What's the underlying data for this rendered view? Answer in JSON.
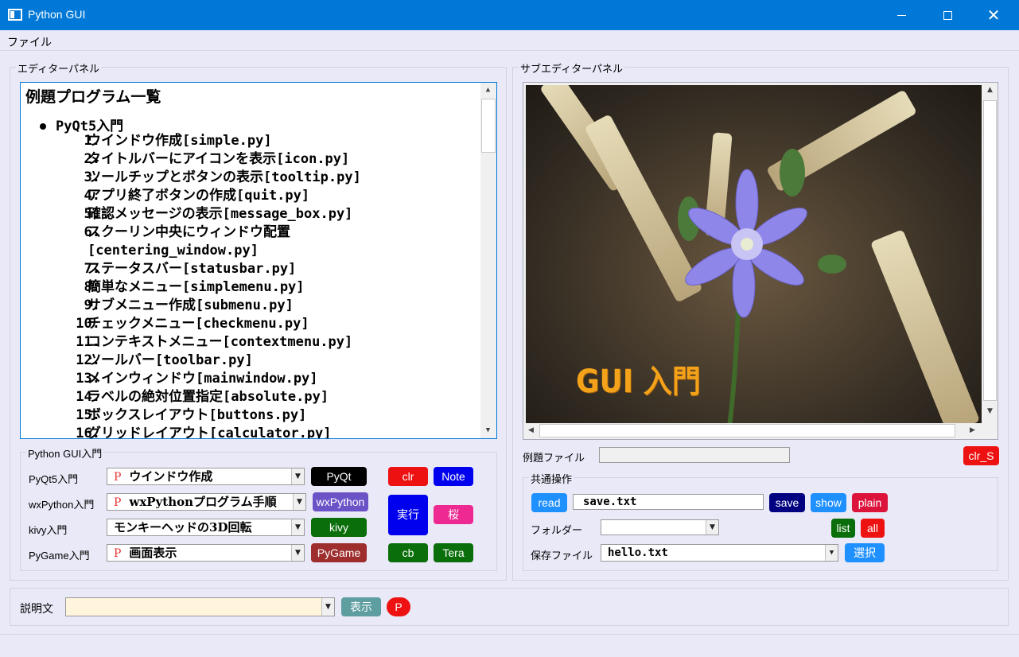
{
  "window": {
    "title": "Python GUI"
  },
  "menu": {
    "file": "ファイル"
  },
  "editor_panel": {
    "title": "エディターパネル",
    "heading": "例題プログラム一覧",
    "section": "PyQt5入門",
    "items": [
      {
        "num": "1.",
        "text": "ウインドウ作成[simple.py]"
      },
      {
        "num": "2.",
        "text": "タイトルバーにアイコンを表示[icon.py]"
      },
      {
        "num": "3.",
        "text": "ツールチップとボタンの表示[tooltip.py]"
      },
      {
        "num": "4.",
        "text": "アプリ終了ボタンの作成[quit.py]"
      },
      {
        "num": "5.",
        "text": "確認メッセージの表示[message_box.py]"
      },
      {
        "num": "6.",
        "text": "スクーリン中央にウィンドウ配置"
      },
      {
        "num": "",
        "text": "[centering_window.py]"
      },
      {
        "num": "7.",
        "text": "ステータスバー[statusbar.py]"
      },
      {
        "num": "8.",
        "text": "簡単なメニュー[simplemenu.py]"
      },
      {
        "num": "9.",
        "text": "サブメニュー作成[submenu.py]"
      },
      {
        "num": "10.",
        "text": "チェックメニュー[checkmenu.py]"
      },
      {
        "num": "11.",
        "text": "コンテキストメニュー[contextmenu.py]"
      },
      {
        "num": "12.",
        "text": "ツールバー[toolbar.py]"
      },
      {
        "num": "13.",
        "text": "メインウィンドウ[mainwindow.py]"
      },
      {
        "num": "14.",
        "text": "ラベルの絶対位置指定[absolute.py]"
      },
      {
        "num": "15.",
        "text": "ボックスレイアウト[buttons.py]"
      },
      {
        "num": "16.",
        "text": "グリッドレイアウト[calculator.py]"
      }
    ]
  },
  "sub_panel": {
    "title": "サブエディターパネル",
    "image_caption": "GUI 入門",
    "example_file_label": "例題ファイル",
    "example_file_value": "",
    "clr_s": "clr_S"
  },
  "gui_intro": {
    "title": "Python GUI入門",
    "rows": [
      {
        "label": "PyQt5入門",
        "value": "ウインドウ作成",
        "button": "PyQt"
      },
      {
        "label": "wxPython入門",
        "value": "wxPythonプログラム手順",
        "button": "wxPython"
      },
      {
        "label": "kivy入門",
        "value": "モンキーヘッドの3D回転",
        "button": "kivy"
      },
      {
        "label": "PyGame入門",
        "value": "画面表示",
        "button": "PyGame"
      }
    ],
    "p_mark": "P",
    "buttons": {
      "clr": "clr",
      "note": "Note",
      "run": "実行",
      "sakura": "桜",
      "cb": "cb",
      "tera": "Tera"
    }
  },
  "common_ops": {
    "title": "共通操作",
    "read": "read",
    "file_value": "save.txt",
    "save": "save",
    "show": "show",
    "plain": "plain",
    "folder_label": "フォルダー",
    "folder_value": "",
    "list": "list",
    "all": "all",
    "save_file_label": "保存ファイル",
    "save_file_value": "hello.txt",
    "select": "選択"
  },
  "bottom": {
    "desc_label": "説明文",
    "desc_value": "",
    "display": "表示",
    "p": "P"
  },
  "colors": {
    "titlebar": "#0078d7",
    "window_bg": "#e9e9f8",
    "black_btn": "#000000",
    "purple_btn": "#6b52c7",
    "green_btn": "#0a6e0a",
    "brown_btn": "#9e2e2e",
    "red_btn": "#ee1111",
    "blue_btn": "#0000ee",
    "pink_btn": "#ee2a92",
    "navy_btn": "#000080",
    "light_blue_btn": "#1e90ff",
    "crimson_btn": "#dc143c",
    "teal_btn": "#5f9ea0"
  }
}
